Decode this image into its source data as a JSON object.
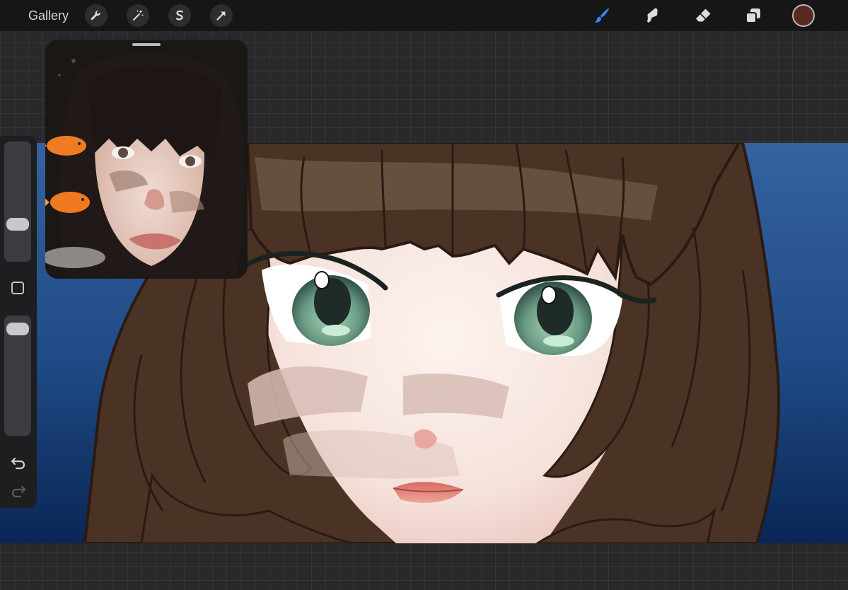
{
  "topbar": {
    "gallery_label": "Gallery",
    "left_tools": [
      "wrench-icon",
      "magic-wand-icon",
      "selection-icon",
      "transform-arrow-icon"
    ],
    "right_tools": [
      "brush-icon",
      "smudge-icon",
      "eraser-icon",
      "layers-icon"
    ],
    "active_tool": "brush-icon",
    "active_color": "#5a2a22",
    "accent_color": "#3b82f6"
  },
  "sidebar": {
    "brush_size_level": 0.72,
    "opacity_level": 0.05,
    "buttons": [
      "modify-square-icon",
      "undo-icon",
      "redo-icon"
    ]
  },
  "reference_window": {
    "visible": true
  }
}
